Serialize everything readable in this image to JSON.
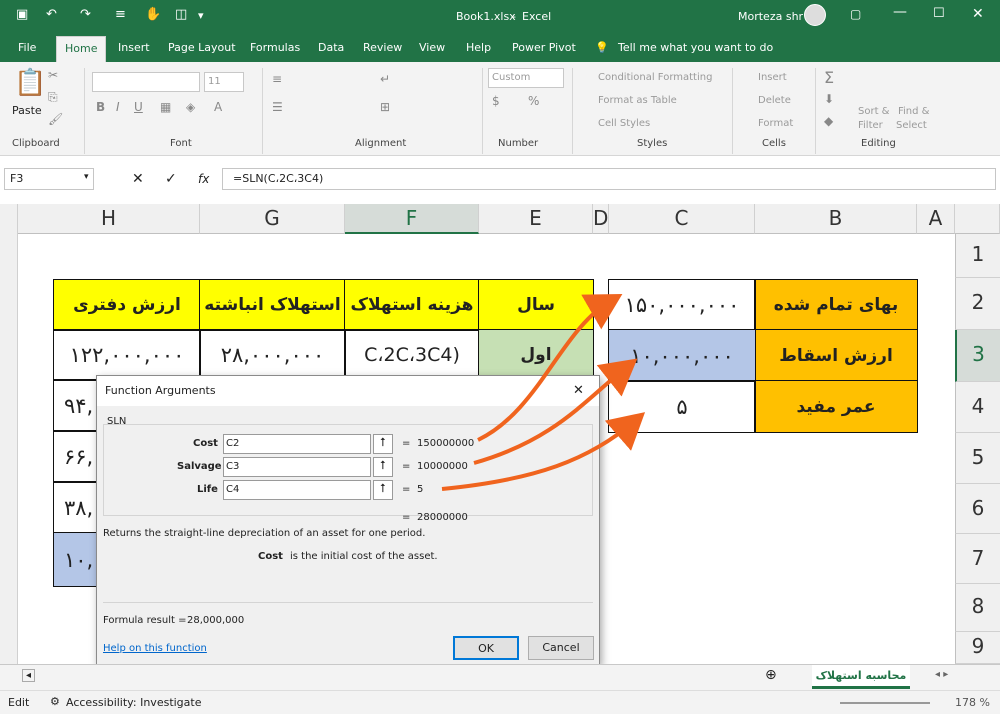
{
  "titlebar": {
    "filename": "Book1.xlsx",
    "separator": "-",
    "app": "Excel",
    "user": "Morteza shr"
  },
  "tabs": [
    "File",
    "Home",
    "Insert",
    "Page Layout",
    "Formulas",
    "Data",
    "Review",
    "View",
    "Help",
    "Power Pivot"
  ],
  "tell_me": "Tell me what you want to do",
  "ribbon": {
    "paste": "Paste",
    "clipboard": "Clipboard",
    "font": "Font",
    "font_size": "11",
    "alignment": "Alignment",
    "number_format": "Custom",
    "number": "Number",
    "cond_format": "Conditional Formatting",
    "format_table": "Format as Table",
    "cell_styles": "Cell Styles",
    "styles": "Styles",
    "insert": "Insert",
    "delete": "Delete",
    "format": "Format",
    "cells": "Cells",
    "sort": "Sort &",
    "filter": "Filter",
    "find": "Find &",
    "select": "Select",
    "editing": "Editing"
  },
  "namebox": "F3",
  "formula": "=SLN(C،2C،3C4)",
  "fx": "fx",
  "columns": [
    "H",
    "G",
    "F",
    "E",
    "D",
    "C",
    "B",
    "A"
  ],
  "rows": [
    "1",
    "2",
    "3",
    "4",
    "5",
    "6",
    "7",
    "8",
    "9"
  ],
  "table1": {
    "headers": [
      "ارزش دفتری",
      "استهلاک انباشته",
      "هزینه استهلاک",
      "سال"
    ],
    "row3": [
      "۱۲۲,۰۰۰,۰۰۰",
      "۲۸,۰۰۰,۰۰۰",
      "C،2C،3C4)",
      "اول"
    ],
    "partial": [
      "۹۴,",
      "۶۶,",
      "۳۸,",
      "۱۰,"
    ]
  },
  "table2": {
    "labels": [
      "بهای تمام شده",
      "ارزش اسقاط",
      "عمر مفید"
    ],
    "values": [
      "۱۵۰,۰۰۰,۰۰۰",
      "۱۰,۰۰۰,۰۰۰",
      "۵"
    ]
  },
  "dialog": {
    "title": "Function Arguments",
    "func": "SLN",
    "args": [
      {
        "label": "Cost",
        "value": "C2",
        "result": "150000000"
      },
      {
        "label": "Salvage",
        "value": "C3",
        "result": "10000000"
      },
      {
        "label": "Life",
        "value": "C4",
        "result": "5"
      }
    ],
    "eq": "=",
    "total": "28000000",
    "description": "Returns the straight-line depreciation of an asset for one period.",
    "arg_help_name": "Cost",
    "arg_help_text": "is the initial cost of the asset.",
    "result_label": "Formula result =",
    "result_value": "28,000,000",
    "help_link": "Help on this function",
    "ok": "OK",
    "cancel": "Cancel",
    "close": "✕"
  },
  "sheet_tab": "محاسبه استهلاک",
  "status": {
    "mode": "Edit",
    "accessibility": "Accessibility: Investigate",
    "zoom": "178 %"
  },
  "colors": {
    "green": "#217346",
    "yellow": "#ffff00",
    "orange": "#ffc000",
    "blue": "#b4c6e7",
    "lightgreen": "#c6e0b4",
    "arrow": "#f0641e"
  }
}
